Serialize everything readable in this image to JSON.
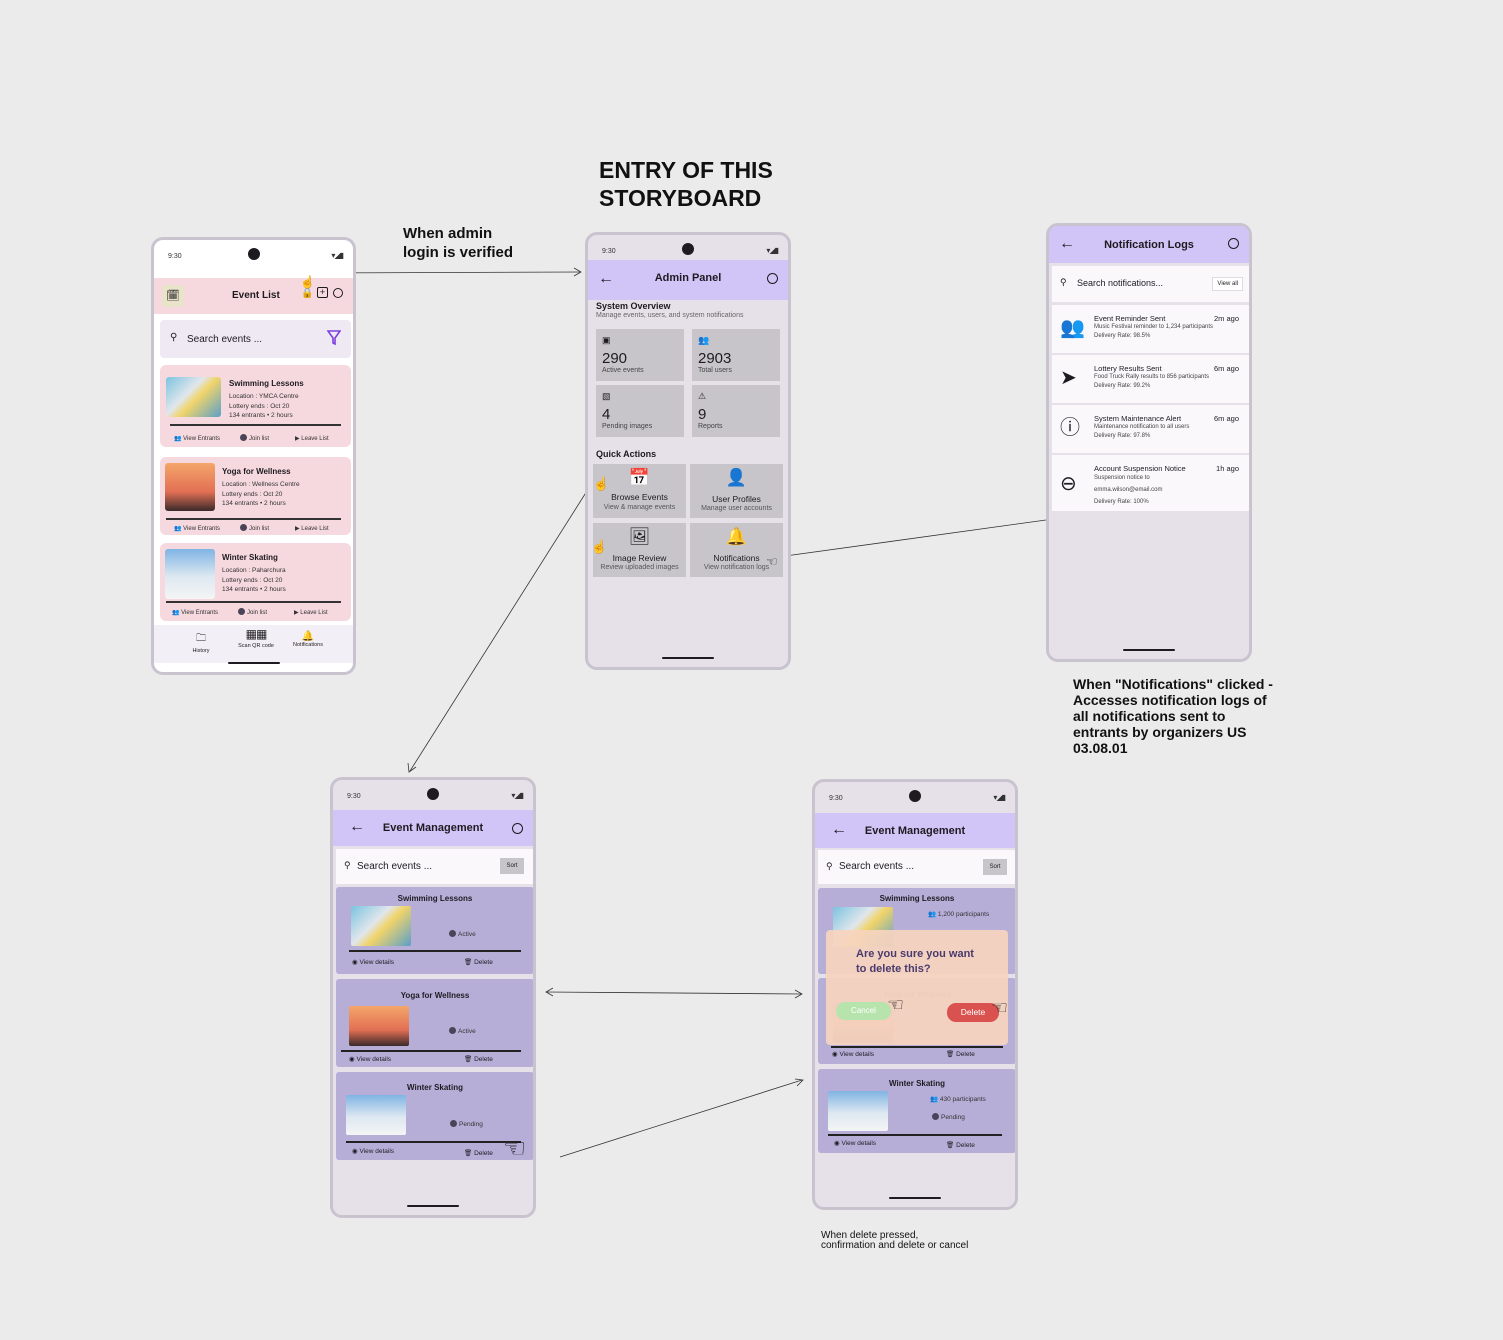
{
  "annotations": {
    "entry_title_l1": "ENTRY OF THIS",
    "entry_title_l2": "STORYBOARD",
    "admin_login_l1": "When admin",
    "admin_login_l2": "login is verified",
    "notif_l1": "When \"Notifications\" clicked -",
    "notif_l2": "Accesses notification logs of",
    "notif_l3": "all notifications sent to",
    "notif_l4": "entrants by organizers US",
    "notif_l5": "03.08.01",
    "delete_l1": "When delete pressed,",
    "delete_l2": "confirmation and delete or cancel"
  },
  "status_time": "9:30",
  "event_list": {
    "title": "Event List",
    "search_placeholder": "Search events ...",
    "events": [
      {
        "name": "Swimming Lessons",
        "location": "Location  : YMCA Centre",
        "lottery": "Lottery ends : Oct 20",
        "meta": "134 entrants  • 2 hours"
      },
      {
        "name": "Yoga for Wellness",
        "location": "Location  :  Wellness Centre",
        "lottery": "Lottery ends : Oct 20",
        "meta": "134 entrants  • 2 hours"
      },
      {
        "name": "Winter Skating",
        "location": "Location  : Paharchura",
        "lottery": "Lottery ends : Oct 20",
        "meta": "134 entrants  • 2 hours"
      }
    ],
    "actions": {
      "view": "View Entrants",
      "join": "Join list",
      "leave": "Leave List"
    },
    "nav": {
      "history": "History",
      "scan": "Scan QR code",
      "notifications": "Notifications"
    }
  },
  "admin_panel": {
    "title": "Admin Panel",
    "overview_title": "System Overview",
    "overview_subtitle": "Manage events, users, and system notifications",
    "stats": [
      {
        "value": "290",
        "label": "Active events",
        "icon": "calendar-icon"
      },
      {
        "value": "2903",
        "label": "Total users",
        "icon": "users-icon"
      },
      {
        "value": "4",
        "label": "Pending images",
        "icon": "image-icon"
      },
      {
        "value": "9",
        "label": "Reports",
        "icon": "warning-icon"
      }
    ],
    "quick_actions_title": "Quick Actions",
    "quick_actions": [
      {
        "title": "Browse Events",
        "subtitle": "View & manage events"
      },
      {
        "title": "User Profiles",
        "subtitle": "Manage user accounts"
      },
      {
        "title": "Image Review",
        "subtitle": "Review uploaded images"
      },
      {
        "title": "Notifications",
        "subtitle": "View notification logs"
      }
    ]
  },
  "notification_logs": {
    "title": "Notification Logs",
    "search_placeholder": "Search notifications...",
    "view_all": "View all",
    "items": [
      {
        "title": "Event Reminder Sent",
        "time": "2m ago",
        "desc1": "Music Festival reminder to 1,234 participants",
        "desc2": "Delivery Rate: 98.5%"
      },
      {
        "title": "Lottery Results Sent",
        "time": "6m ago",
        "desc1": "Food Truck Rally results to 856 participants",
        "desc2": "Delivery Rate: 99.2%"
      },
      {
        "title": "System Maintenance Alert",
        "time": "6m ago",
        "desc1": "Maintenance notification to all users",
        "desc2": "Delivery Rate: 97.8%"
      },
      {
        "title": "Account Suspension Notice",
        "time": "1h ago",
        "desc1": "Suspension notice to",
        "desc2": "emma.wilson@email.com",
        "desc3": "Delivery Rate: 100%"
      }
    ]
  },
  "event_management": {
    "title": "Event Management",
    "search_placeholder": "Search events ...",
    "sort": "Sort",
    "events": [
      {
        "name": "Swimming Lessons",
        "status": "Active",
        "participants": "1,200 participants"
      },
      {
        "name": "Yoga for Wellness",
        "status": "Active",
        "participants": ""
      },
      {
        "name": "Winter Skating",
        "status": "Pending",
        "participants": "430 participants"
      }
    ],
    "view_details": "View details",
    "delete": "Delete",
    "dialog": {
      "question_l1": "Are you sure you want",
      "question_l2": "to delete this?",
      "cancel": "Cancel",
      "delete": "Delete"
    }
  }
}
